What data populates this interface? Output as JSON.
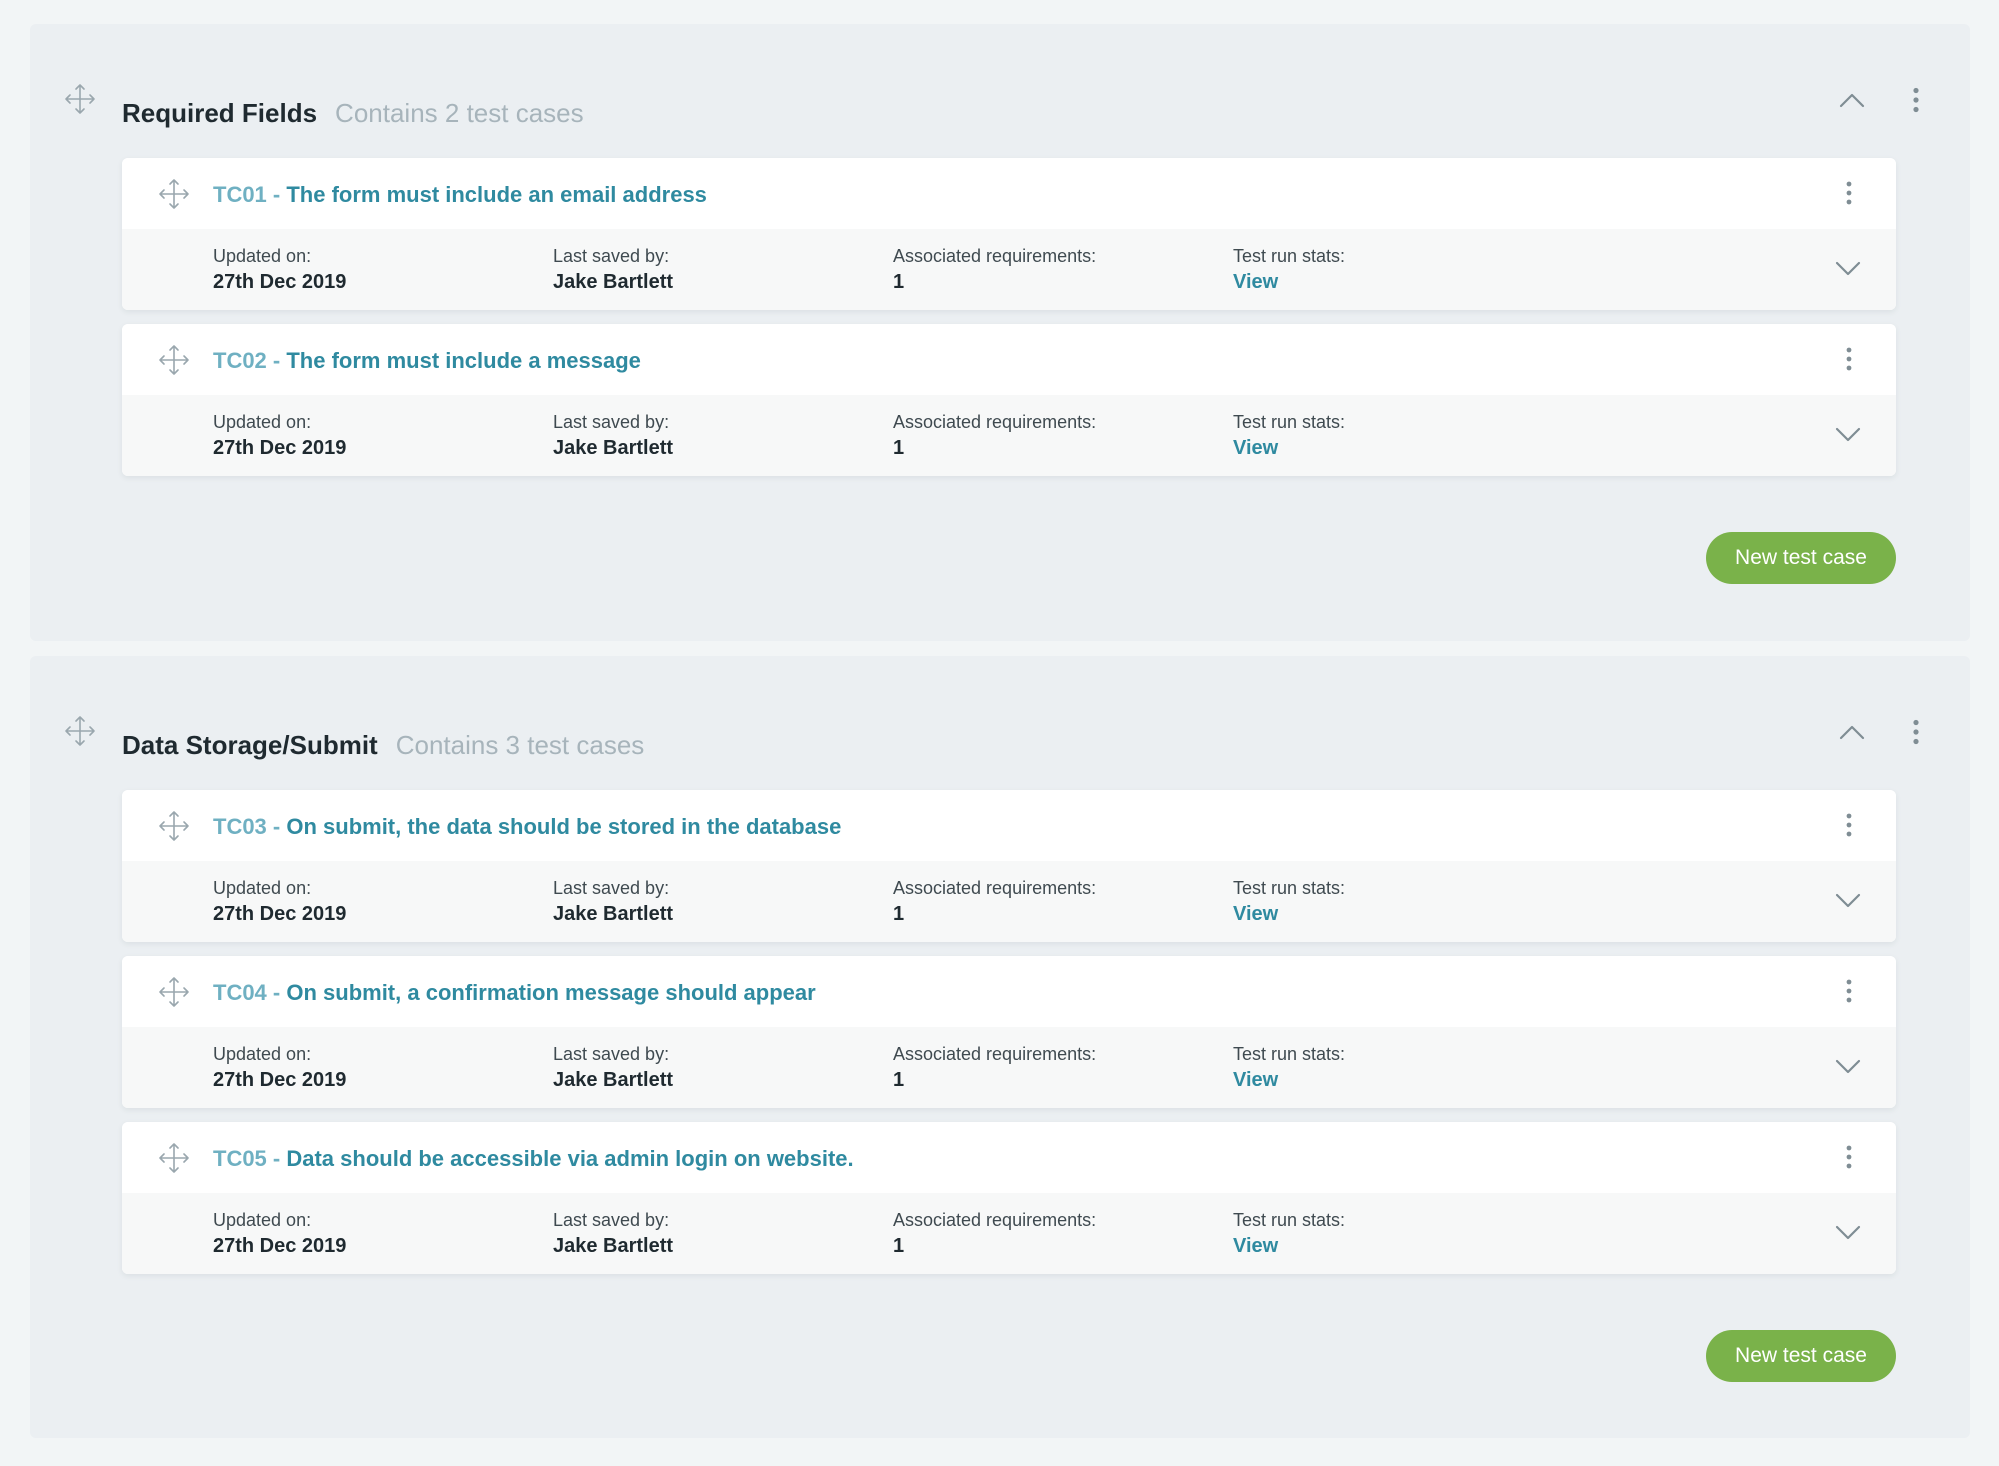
{
  "colors": {
    "page_bg": "#f2f5f6",
    "group_bg": "#ebeff2",
    "accent": "#2f8aa0",
    "accent_light": "#6fb0c2",
    "button_green": "#7ab24a",
    "muted": "#a7b4bb"
  },
  "icons": {
    "drag": "move-arrows-icon",
    "collapse": "chevron-up-icon",
    "expand": "chevron-down-icon",
    "menu": "more-vertical-icon"
  },
  "groups": [
    {
      "title": "Required Fields",
      "subtitle": "Contains 2 test cases",
      "new_button": "New test case",
      "cases": [
        {
          "code": "TC01",
          "separator": " - ",
          "title": "The form must include an email address",
          "updated_label": "Updated on:",
          "updated_value": "27th Dec 2019",
          "saved_label": "Last saved by:",
          "saved_value": "Jake Bartlett",
          "req_label": "Associated requirements:",
          "req_value": "1",
          "stats_label": "Test run stats:",
          "stats_link": "View"
        },
        {
          "code": "TC02",
          "separator": " - ",
          "title": "The form must include a message",
          "updated_label": "Updated on:",
          "updated_value": "27th Dec 2019",
          "saved_label": "Last saved by:",
          "saved_value": "Jake Bartlett",
          "req_label": "Associated requirements:",
          "req_value": "1",
          "stats_label": "Test run stats:",
          "stats_link": "View"
        }
      ]
    },
    {
      "title": "Data Storage/Submit",
      "subtitle": "Contains 3 test cases",
      "new_button": "New test case",
      "cases": [
        {
          "code": "TC03",
          "separator": " - ",
          "title": "On submit, the data should be stored in the database",
          "updated_label": "Updated on:",
          "updated_value": "27th Dec 2019",
          "saved_label": "Last saved by:",
          "saved_value": "Jake Bartlett",
          "req_label": "Associated requirements:",
          "req_value": "1",
          "stats_label": "Test run stats:",
          "stats_link": "View"
        },
        {
          "code": "TC04",
          "separator": " - ",
          "title": "On submit, a confirmation message should appear",
          "updated_label": "Updated on:",
          "updated_value": "27th Dec 2019",
          "saved_label": "Last saved by:",
          "saved_value": "Jake Bartlett",
          "req_label": "Associated requirements:",
          "req_value": "1",
          "stats_label": "Test run stats:",
          "stats_link": "View"
        },
        {
          "code": "TC05",
          "separator": " - ",
          "title": "Data should be accessible via admin login on website.",
          "updated_label": "Updated on:",
          "updated_value": "27th Dec 2019",
          "saved_label": "Last saved by:",
          "saved_value": "Jake Bartlett",
          "req_label": "Associated requirements:",
          "req_value": "1",
          "stats_label": "Test run stats:",
          "stats_link": "View"
        }
      ]
    }
  ]
}
